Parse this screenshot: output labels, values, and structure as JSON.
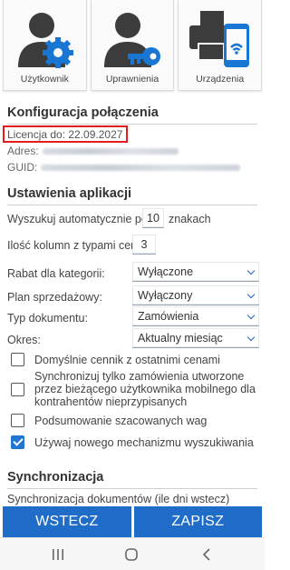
{
  "tiles": [
    {
      "label": "Użytkownik",
      "icon": "user-gear-icon"
    },
    {
      "label": "Uprawnienia",
      "icon": "user-key-icon"
    },
    {
      "label": "Urządzenia",
      "icon": "printer-phone-icon"
    }
  ],
  "connection": {
    "title": "Konfiguracja połączenia",
    "license": "Licencja do: 22.09.2027",
    "address_label": "Adres:",
    "guid_label": "GUID:"
  },
  "settings": {
    "title": "Ustawienia aplikacji",
    "auto_search_label": "Wyszukuj automatycznie po",
    "auto_search_value": "10",
    "auto_search_suffix": "znakach",
    "price_columns_label": "Ilość kolumn z typami cen:",
    "price_columns_value": "3",
    "rows": [
      {
        "label": "Rabat dla kategorii:",
        "value": "Wyłączone"
      },
      {
        "label": "Plan sprzedażowy:",
        "value": "Wyłączony"
      },
      {
        "label": "Typ dokumentu:",
        "value": "Zamówienia"
      },
      {
        "label": "Okres:",
        "value": "Aktualny miesiąc"
      }
    ],
    "checkboxes": [
      {
        "label": "Domyślnie cennik z ostatnimi cenami",
        "checked": false
      },
      {
        "label": "Synchronizuj tylko zamówienia utworzone przez bieżącego użytkownika mobilnego dla kontrahentów nieprzypisanych",
        "checked": false
      },
      {
        "label": "Podsumowanie szacowanych wag",
        "checked": false
      },
      {
        "label": "Używaj nowego mechanizmu wyszukiwania",
        "checked": true
      }
    ]
  },
  "sync": {
    "title": "Synchronizacja",
    "docs_label": "Synchronizacja dokumentów (ile dni wstecz)"
  },
  "buttons": {
    "back": "WSTECZ",
    "save": "ZAPISZ"
  },
  "colors": {
    "primary": "#1f6cc9",
    "icon_blue": "#1976d2",
    "license_highlight": "#e01e1e"
  }
}
